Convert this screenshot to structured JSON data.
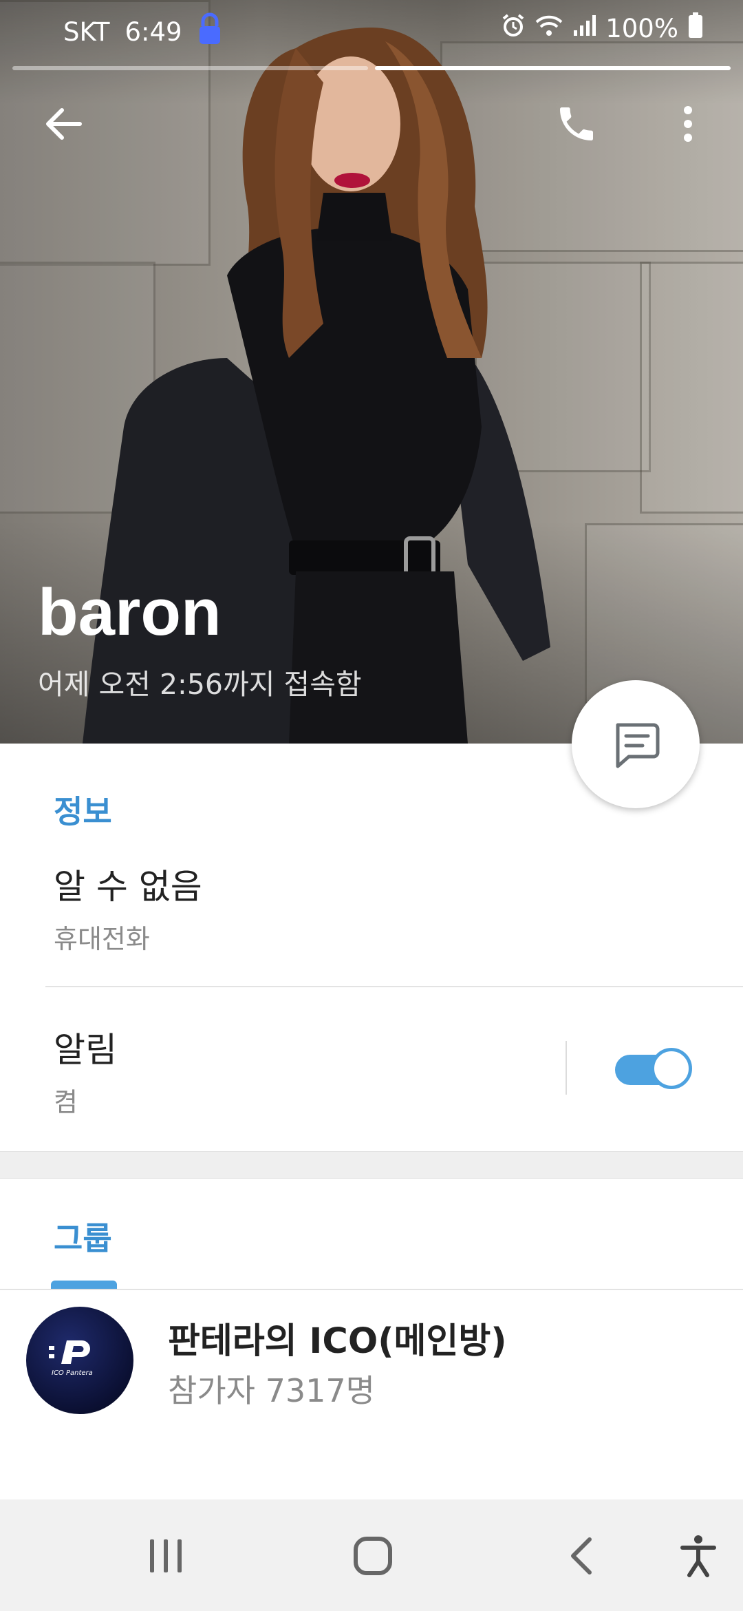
{
  "status_bar": {
    "carrier": "SKT",
    "time": "6:49",
    "battery": "100%",
    "icons": [
      "lock-icon",
      "alarm-icon",
      "wifi-icon",
      "signal-icon",
      "battery-icon"
    ]
  },
  "stories": {
    "count": 2,
    "active_index": 1
  },
  "profile": {
    "name": "baron",
    "last_seen": "어제 오전 2:56까지 접속함"
  },
  "info": {
    "section_title": "정보",
    "phone_value": "알 수 없음",
    "phone_label": "휴대전화",
    "notifications_title": "알림",
    "notifications_value": "켬",
    "notifications_enabled": true
  },
  "groups": {
    "tab_title": "그룹",
    "items": [
      {
        "name": "판테라의 ICO(메인방)",
        "members": "참가자 7317명",
        "avatar_text": "ICO Pantera"
      }
    ]
  },
  "colors": {
    "accent": "#3a8fd1",
    "toggle": "#4da2e0"
  }
}
